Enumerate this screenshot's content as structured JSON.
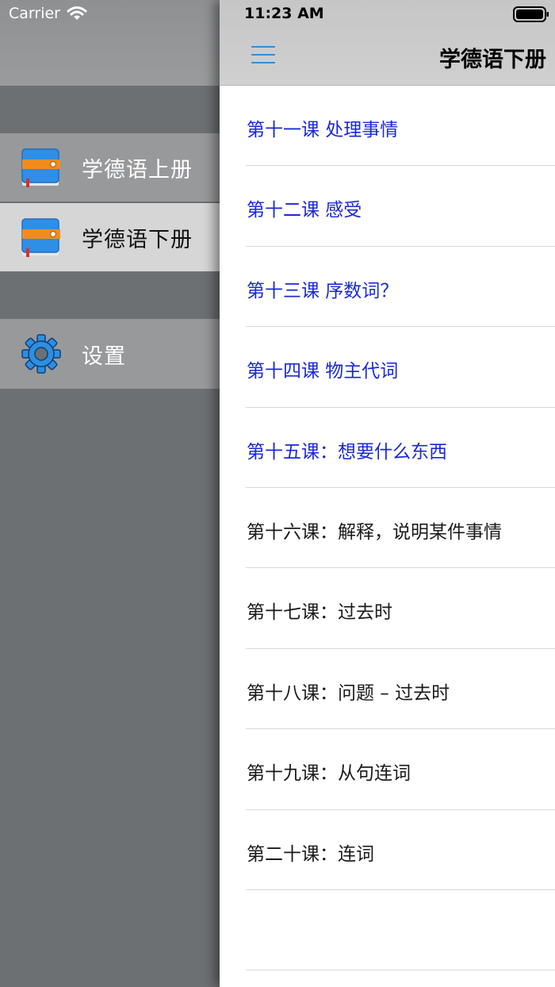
{
  "status_bar": {
    "carrier": "Carrier",
    "time": "11:23 AM"
  },
  "side_menu": {
    "items": [
      {
        "label": "学德语上册",
        "icon": "book-icon",
        "state": "normal"
      },
      {
        "label": "学德语下册",
        "icon": "book-icon",
        "state": "selected"
      },
      {
        "label": "设置",
        "icon": "gear-icon",
        "state": "normal"
      }
    ]
  },
  "nav_bar": {
    "title": "学德语下册",
    "menu_icon": "hamburger-icon"
  },
  "lessons": [
    {
      "title": "第十一课 处理事情",
      "style": "blue"
    },
    {
      "title": "第十二课 感受",
      "style": "blue"
    },
    {
      "title": "第十三课 序数词？",
      "style": "blue"
    },
    {
      "title": "第十四课 物主代词",
      "style": "blue"
    },
    {
      "title": "第十五课：想要什么东西",
      "style": "blue"
    },
    {
      "title": "第十六课：解释，说明某件事情",
      "style": "dark"
    },
    {
      "title": "第十七课：过去时",
      "style": "dark"
    },
    {
      "title": "第十八课：问题 – 过去时",
      "style": "dark"
    },
    {
      "title": "第十九课：从句连词",
      "style": "dark"
    },
    {
      "title": "第二十课：连词",
      "style": "dark"
    },
    {
      "title": "",
      "style": "dark"
    }
  ],
  "colors": {
    "link_blue": "#1a28d8",
    "menu_background": "#6d7073",
    "selected_item": "#d6d6d6",
    "accent_blue": "#2d8fe0"
  }
}
